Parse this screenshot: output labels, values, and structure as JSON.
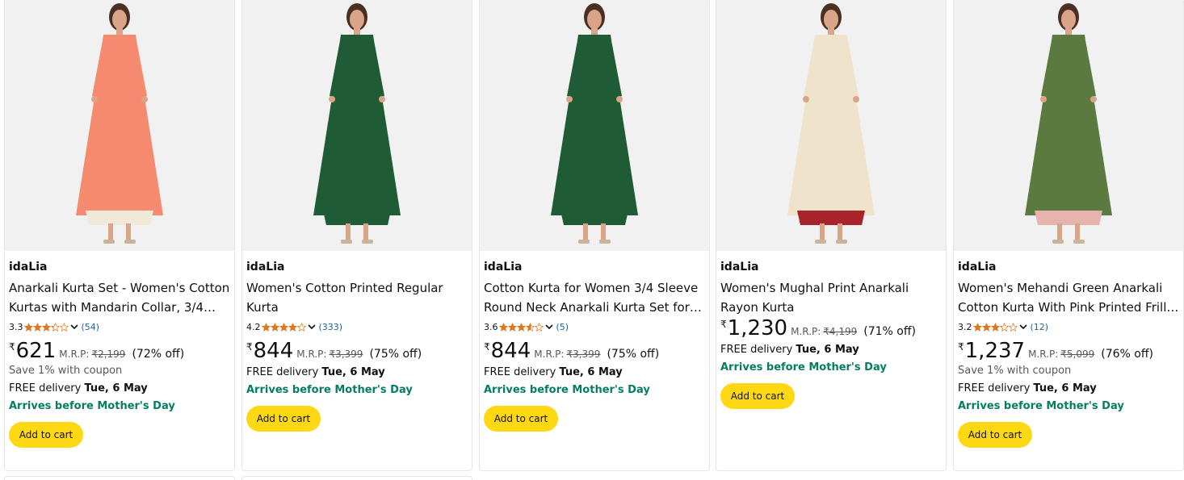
{
  "colors": {
    "cta": "#ffd814",
    "link": "#2162a1",
    "green": "#067d62",
    "star": "#de7921"
  },
  "products": [
    {
      "brand": "idaLia",
      "title": "Anarkali Kurta Set - Women's Cotton Kurtas with Mandarin Collar, 3/4…",
      "rating": "3.3",
      "rating_value": 3.3,
      "reviews": "(54)",
      "rupee": "₹",
      "price": "621",
      "mrp_label": "M.R.P:",
      "mrp": "₹2,199",
      "discount": "(72% off)",
      "coupon": "Save 1% with coupon",
      "delivery_prefix": "FREE delivery ",
      "delivery_date": "Tue, 6 May",
      "arrives": "Arrives before Mother's Day",
      "cta": "Add to cart",
      "dress_color": "#f58a6e",
      "bottom_color": "#f1e9d8"
    },
    {
      "brand": "idaLia",
      "title": "Women's Cotton Printed Regular Kurta",
      "rating": "4.2",
      "rating_value": 4.2,
      "reviews": "(333)",
      "rupee": "₹",
      "price": "844",
      "mrp_label": "M.R.P:",
      "mrp": "₹3,399",
      "discount": "(75% off)",
      "coupon": "",
      "delivery_prefix": "FREE delivery ",
      "delivery_date": "Tue, 6 May",
      "arrives": "Arrives before Mother's Day",
      "cta": "Add to cart",
      "dress_color": "#1f5c35",
      "bottom_color": "#1f5c35"
    },
    {
      "brand": "idaLia",
      "title": "Cotton Kurta for Women 3/4 Sleeve Round Neck Anarkali Kurta Set for…",
      "rating": "3.6",
      "rating_value": 3.6,
      "reviews": "(5)",
      "rupee": "₹",
      "price": "844",
      "mrp_label": "M.R.P:",
      "mrp": "₹3,399",
      "discount": "(75% off)",
      "coupon": "",
      "delivery_prefix": "FREE delivery ",
      "delivery_date": "Tue, 6 May",
      "arrives": "Arrives before Mother's Day",
      "cta": "Add to cart",
      "dress_color": "#1f5c35",
      "bottom_color": "#1f5c35"
    },
    {
      "brand": "idaLia",
      "title": "Women's Mughal Print Anarkali Rayon Kurta",
      "rating": "",
      "rating_value": null,
      "reviews": "",
      "rupee": "₹",
      "price": "1,230",
      "mrp_label": "M.R.P:",
      "mrp": "₹4,199",
      "discount": "(71% off)",
      "coupon": "",
      "delivery_prefix": "FREE delivery ",
      "delivery_date": "Tue, 6 May",
      "arrives": "Arrives before Mother's Day",
      "cta": "Add to cart",
      "dress_color": "#efe3cc",
      "bottom_color": "#a8232a"
    },
    {
      "brand": "idaLia",
      "title": "Women's Mehandi Green Anarkali Cotton Kurta With Pink Printed Frill…",
      "rating": "3.2",
      "rating_value": 3.2,
      "reviews": "(12)",
      "rupee": "₹",
      "price": "1,237",
      "mrp_label": "M.R.P:",
      "mrp": "₹5,099",
      "discount": "(76% off)",
      "coupon": "Save 1% with coupon",
      "delivery_prefix": "FREE delivery ",
      "delivery_date": "Tue, 6 May",
      "arrives": "Arrives before Mother's Day",
      "cta": "Add to cart",
      "dress_color": "#5b7a3f",
      "bottom_color": "#e6b3ae"
    }
  ]
}
